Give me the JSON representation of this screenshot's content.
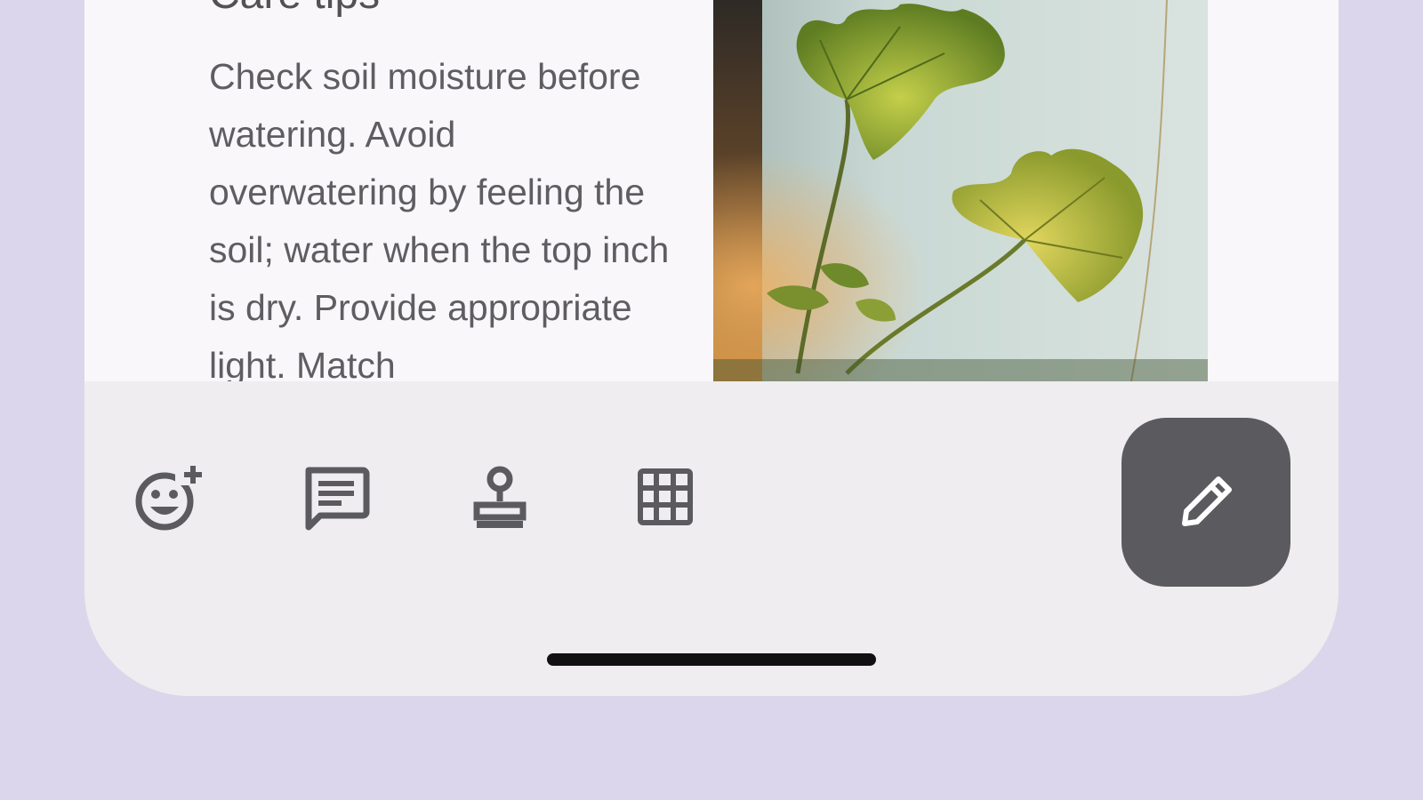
{
  "note": {
    "title": "Care tips",
    "body": "Check soil moisture before watering. Avoid overwatering by feeling the soil; water when the top inch is dry. Provide appropriate light. Match",
    "photo": {
      "subject": "plant-leaves-by-window"
    }
  },
  "toolbar": {
    "items": [
      {
        "name": "emoji-add",
        "icon": "emoji-add-icon"
      },
      {
        "name": "comment",
        "icon": "comment-icon"
      },
      {
        "name": "stamp",
        "icon": "stamp-icon"
      },
      {
        "name": "grid",
        "icon": "grid-icon"
      }
    ],
    "fab_icon": "pencil-icon"
  },
  "colors": {
    "background": "#dcd6ec",
    "surface": "#efedef",
    "card": "#f9f7f9",
    "icon": "#5b5b5f",
    "fab": "#5b5b5f",
    "fab_icon": "#ffffff",
    "text": "#5e5d61"
  }
}
